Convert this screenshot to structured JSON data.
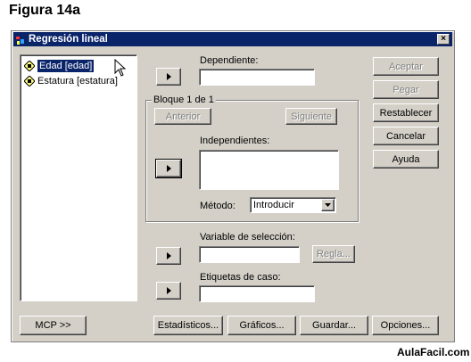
{
  "figure_title": "Figura 14a",
  "window": {
    "title": "Regresión lineal",
    "close_label": "×"
  },
  "variables": [
    {
      "label": "Edad [edad]",
      "selected": true
    },
    {
      "label": "Estatura [estatura]",
      "selected": false
    }
  ],
  "dependent": {
    "label": "Dependiente:",
    "value": ""
  },
  "block": {
    "title": "Bloque 1 de 1",
    "prev_label": "Anterior",
    "next_label": "Siguiente"
  },
  "independents": {
    "label": "Independientes:",
    "value": ""
  },
  "method": {
    "label": "Método:",
    "value": "Introducir"
  },
  "selection_var": {
    "label": "Variable de selección:",
    "value": "",
    "rule_label": "Regla..."
  },
  "case_labels": {
    "label": "Etiquetas de caso:",
    "value": ""
  },
  "side_buttons": {
    "accept": "Aceptar",
    "paste": "Pegar",
    "reset": "Restablecer",
    "cancel": "Cancelar",
    "help": "Ayuda"
  },
  "bottom_buttons": {
    "wls": "MCP >>",
    "stats": "Estadísticos...",
    "plots": "Gráficos...",
    "save": "Guardar...",
    "options": "Opciones..."
  },
  "watermark": "AulaFacil.com",
  "colors": {
    "titlebar": "#0a246a",
    "face": "#d4d0c8"
  }
}
